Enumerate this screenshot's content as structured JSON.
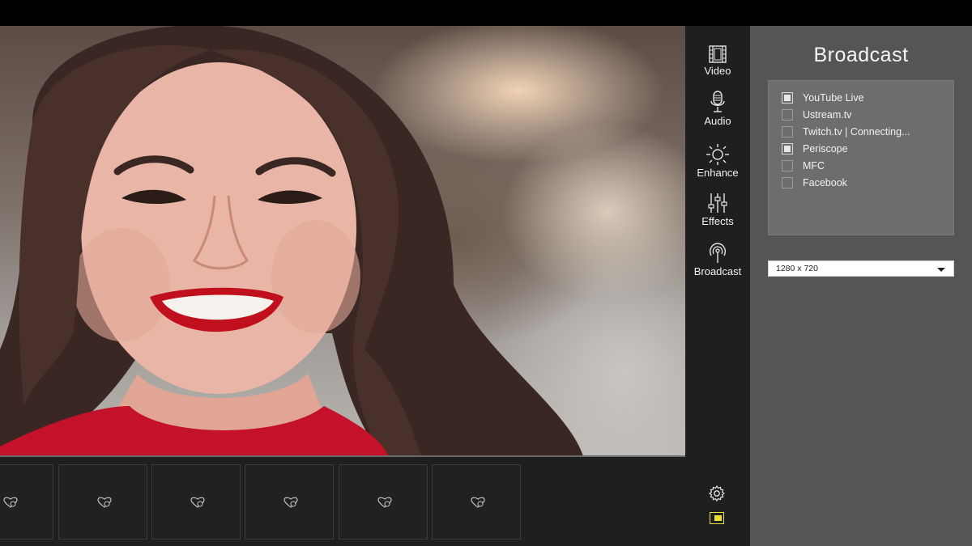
{
  "rail": {
    "items": [
      {
        "label": "Video",
        "icon": "film-icon"
      },
      {
        "label": "Audio",
        "icon": "microphone-icon"
      },
      {
        "label": "Enhance",
        "icon": "sun-icon"
      },
      {
        "label": "Effects",
        "icon": "sliders-icon"
      },
      {
        "label": "Broadcast",
        "icon": "broadcast-icon"
      }
    ]
  },
  "panel": {
    "title": "Broadcast",
    "services": [
      {
        "label": "YouTube Live",
        "checked": true
      },
      {
        "label": "Ustream.tv",
        "checked": false
      },
      {
        "label": "Twitch.tv | Connecting...",
        "checked": false
      },
      {
        "label": "Periscope",
        "checked": true
      },
      {
        "label": "MFC",
        "checked": false
      },
      {
        "label": "Facebook",
        "checked": false
      }
    ],
    "resolution": "1280 x 720"
  },
  "filmstrip": {
    "slot_icon": "heart-camera-icon",
    "slot_count": 6
  },
  "bottom": {
    "settings_icon": "gear-icon",
    "pip_icon": "picture-in-picture-icon"
  },
  "colors": {
    "accent": "#e8e03a",
    "panel_bg": "#555555",
    "rail_bg": "#1f1f1f"
  }
}
